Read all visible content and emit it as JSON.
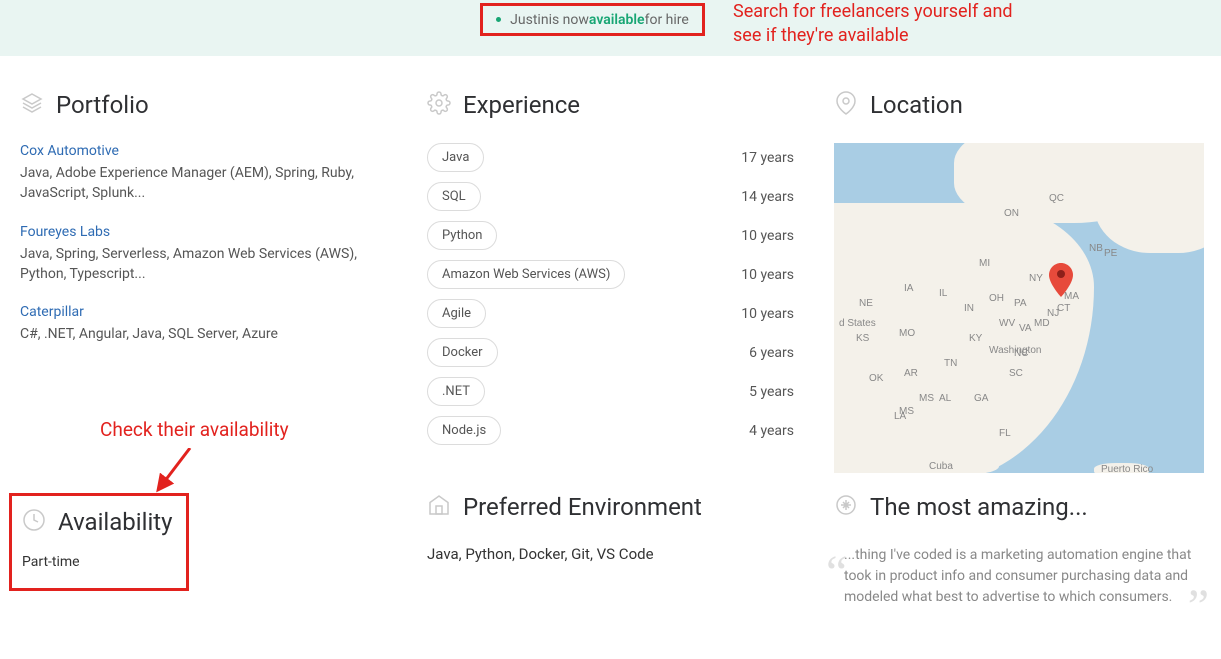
{
  "banner": {
    "name": "Justin",
    "status_word": "available",
    "prefix": " is now ",
    "suffix": " for hire"
  },
  "annotations": {
    "top": "Search for freelancers yourself and see if they're available",
    "availability": "Check their availability"
  },
  "portfolio": {
    "title": "Portfolio",
    "items": [
      {
        "title": "Cox Automotive",
        "tech": "Java, Adobe Experience Manager (AEM), Spring, Ruby, JavaScript, Splunk..."
      },
      {
        "title": "Foureyes Labs",
        "tech": "Java, Spring, Serverless, Amazon Web Services (AWS), Python, Typescript..."
      },
      {
        "title": "Caterpillar",
        "tech": "C#, .NET, Angular, Java, SQL Server, Azure"
      }
    ]
  },
  "experience": {
    "title": "Experience",
    "rows": [
      {
        "skill": "Java",
        "years": "17 years"
      },
      {
        "skill": "SQL",
        "years": "14 years"
      },
      {
        "skill": "Python",
        "years": "10 years"
      },
      {
        "skill": "Amazon Web Services (AWS)",
        "years": "10 years"
      },
      {
        "skill": "Agile",
        "years": "10 years"
      },
      {
        "skill": "Docker",
        "years": "6 years"
      },
      {
        "skill": ".NET",
        "years": "5 years"
      },
      {
        "skill": "Node.js",
        "years": "4 years"
      }
    ]
  },
  "location": {
    "title": "Location",
    "states": [
      "ON",
      "QC",
      "NB",
      "PE",
      "MS",
      "NY",
      "MA",
      "CT",
      "PA",
      "NJ",
      "OH",
      "MI",
      "IN",
      "IL",
      "IA",
      "NE",
      "KS",
      "MO",
      "OK",
      "AR",
      "KY",
      "TN",
      "WV",
      "VA",
      "MD",
      "NC",
      "SC",
      "GA",
      "AL",
      "MS",
      "LA",
      "FL"
    ],
    "country_label": "d States",
    "cuba": "Cuba",
    "pr": "Puerto Rico",
    "washington": "Washington"
  },
  "availability": {
    "title": "Availability",
    "value": "Part-time"
  },
  "environment": {
    "title": "Preferred Environment",
    "value": "Java, Python, Docker, Git, VS Code"
  },
  "amazing": {
    "title": "The most amazing...",
    "body": "...thing I've coded is a marketing automation engine that took in product info and consumer purchasing data and modeled what best to advertise to which consumers."
  }
}
